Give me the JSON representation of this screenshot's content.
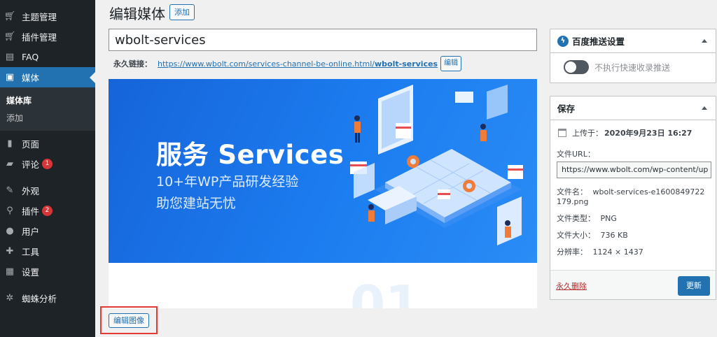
{
  "sidebar": {
    "items": [
      {
        "label": "主题管理",
        "icon": "cart-icon"
      },
      {
        "label": "插件管理",
        "icon": "cart-icon"
      },
      {
        "label": "FAQ",
        "icon": "faq-icon"
      },
      {
        "label": "媒体",
        "icon": "media-icon",
        "active": true
      },
      {
        "label": "页面",
        "icon": "page-icon"
      },
      {
        "label": "评论",
        "icon": "comment-icon",
        "badge": "1"
      },
      {
        "label": "外观",
        "icon": "brush-icon"
      },
      {
        "label": "插件",
        "icon": "plugin-icon",
        "badge": "2"
      },
      {
        "label": "用户",
        "icon": "user-icon"
      },
      {
        "label": "工具",
        "icon": "wrench-icon"
      },
      {
        "label": "设置",
        "icon": "settings-icon"
      },
      {
        "label": "蜘蛛分析",
        "icon": "spider-icon"
      }
    ],
    "submenu": [
      "媒体库",
      "添加"
    ]
  },
  "header": {
    "title": "编辑媒体",
    "add_label": "添加"
  },
  "post": {
    "title_value": "wbolt-services",
    "permalink_label": "永久链接：",
    "permalink_base": "https://www.wbolt.com/services-channel-be-online.html/",
    "permalink_slug": "wbolt-services",
    "permalink_edit": "编辑"
  },
  "image": {
    "banner_title": "服务 Services",
    "banner_sub1": "10+年WP产品研发经验",
    "banner_sub2": "助您建站无忧",
    "watermark": "01"
  },
  "edit_image_label": "编辑图像",
  "baidu_panel": {
    "title": "百度推送设置",
    "toggle_label": "不执行快速收录推送",
    "toggle_on": false
  },
  "save_panel": {
    "title": "保存",
    "uploaded": "上传于：",
    "uploaded_date": "2020年9月23日 16:27",
    "file_url_label": "文件URL：",
    "file_url_value": "https://www.wbolt.com/wp-content/up",
    "file_name_label": "文件名：",
    "file_name_value": "wbolt-services-e1600849722179.png",
    "file_type_label": "文件类型：",
    "file_type_value": "PNG",
    "file_size_label": "文件大小：",
    "file_size_value": "736 KB",
    "resolution_label": "分辨率：",
    "resolution_value": "1124 × 1437",
    "trash_label": "永久删除",
    "update_label": "更新"
  },
  "colors": {
    "accent": "#2271b1",
    "sidebar_bg": "#1d2327",
    "badge": "#d63638",
    "highlight_box": "#e53935"
  }
}
